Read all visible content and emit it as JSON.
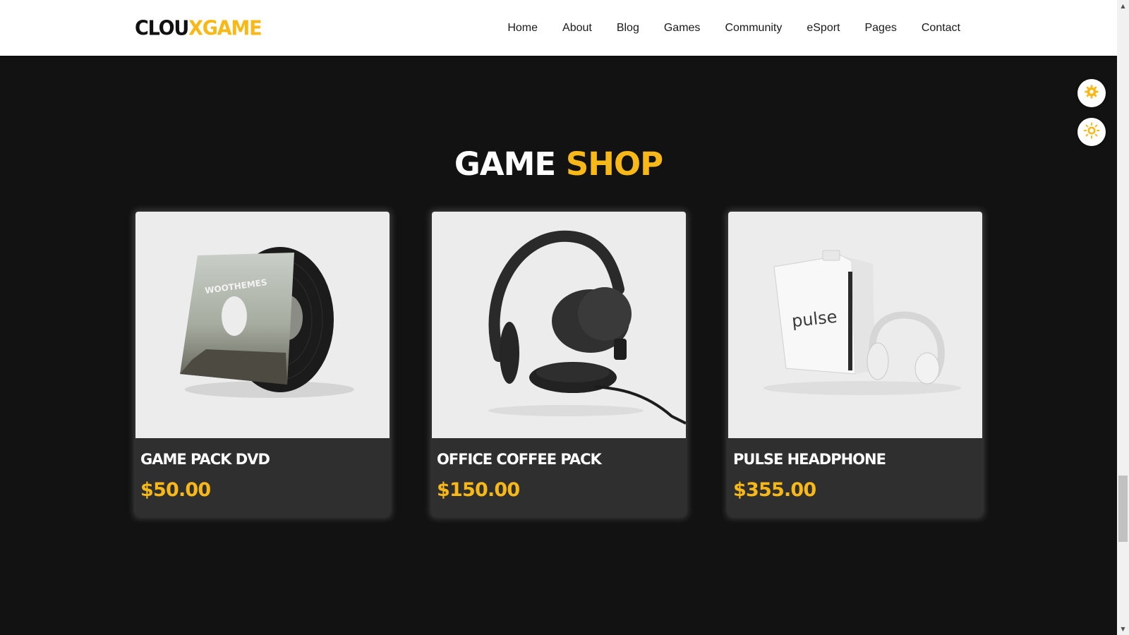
{
  "header": {
    "logo_part1": "CLOU",
    "logo_part2": "XGAME",
    "nav": [
      "Home",
      "About",
      "Blog",
      "Games",
      "Community",
      "eSport",
      "Pages",
      "Contact"
    ]
  },
  "section": {
    "title_part1": "GAME",
    "title_part2": "SHOP"
  },
  "products": [
    {
      "name": "GAME PACK DVD",
      "price": "$50.00",
      "image_icon": "vinyl-record-image"
    },
    {
      "name": "OFFICE COFFEE PACK",
      "price": "$150.00",
      "image_icon": "headphones-image"
    },
    {
      "name": "PULSE HEADPHONE",
      "price": "$355.00",
      "image_icon": "pulse-headphone-box-image"
    }
  ],
  "vinyl_sleeve_text": "WOOTHEMES",
  "pulse_box_text": "pulse",
  "floating_buttons": [
    {
      "icon": "gear-icon"
    },
    {
      "icon": "sun-icon"
    }
  ],
  "colors": {
    "accent": "#f8b918",
    "background": "#121212",
    "card_body": "#2f2f2f",
    "header": "#ffffff"
  }
}
